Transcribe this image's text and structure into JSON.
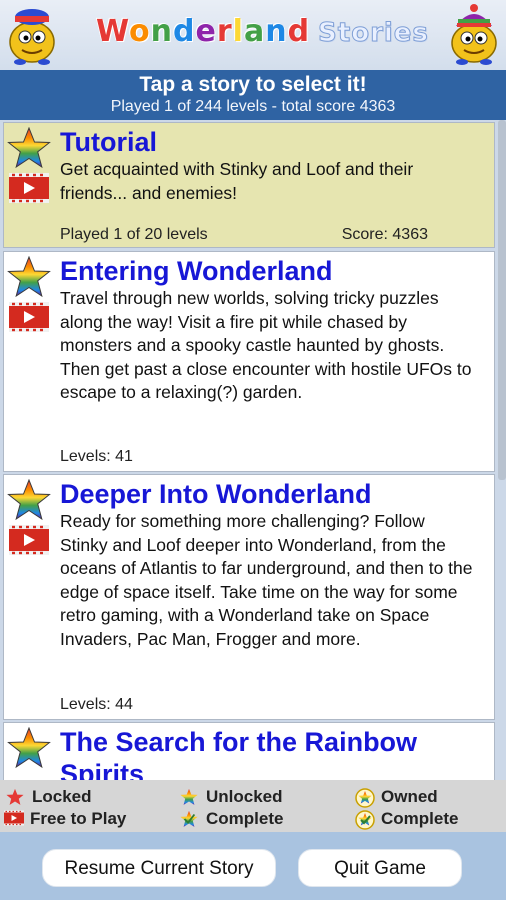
{
  "header": {
    "logo_letters": [
      "W",
      "o",
      "n",
      "d",
      "e",
      "r",
      "l",
      "a",
      "n",
      "d"
    ],
    "logo_colors": [
      "#e53935",
      "#fb8c00",
      "#43a047",
      "#1e88e5",
      "#8e24aa",
      "#e53935",
      "#fdd835",
      "#43a047",
      "#1e88e5",
      "#e53935"
    ],
    "logo_suffix": "Stories"
  },
  "banner": {
    "title": "Tap a story to select it!",
    "subtitle": "Played 1 of 244 levels - total score 4363"
  },
  "stories": [
    {
      "title": "Tutorial",
      "description": "Get acquainted with Stinky and Loof and their friends... and enemies!",
      "footer_left": "Played 1 of 20 levels",
      "footer_right": "Score: 4363",
      "selected": true
    },
    {
      "title": "Entering Wonderland",
      "description": "Travel through new worlds, solving tricky puzzles along the way! Visit a fire pit while chased by monsters and a spooky castle haunted by ghosts. Then get past a close encounter with hostile UFOs to escape to a relaxing(?) garden.",
      "footer_left": "Levels: 41",
      "footer_right": ""
    },
    {
      "title": "Deeper Into Wonderland",
      "description": "Ready for something more challenging? Follow Stinky and Loof deeper into Wonderland, from the oceans of Atlantis to far underground, and then to the edge of space itself.  Take time on the way for some retro gaming, with a Wonderland take on Space Invaders, Pac Man, Frogger and more.",
      "footer_left": "Levels: 44",
      "footer_right": ""
    },
    {
      "title": "The Search for the Rainbow Spirits",
      "description": "",
      "footer_left": "",
      "footer_right": ""
    }
  ],
  "legend": {
    "locked": "Locked",
    "free_to_play": "Free to Play",
    "unlocked": "Unlocked",
    "complete_1": "Complete",
    "owned": "Owned",
    "complete_2": "Complete"
  },
  "buttons": {
    "resume": "Resume Current Story",
    "quit": "Quit Game"
  },
  "colors": {
    "title_blue": "#1717d6",
    "banner_blue": "#2f63a3",
    "selected_bg": "#e6e5b0"
  }
}
